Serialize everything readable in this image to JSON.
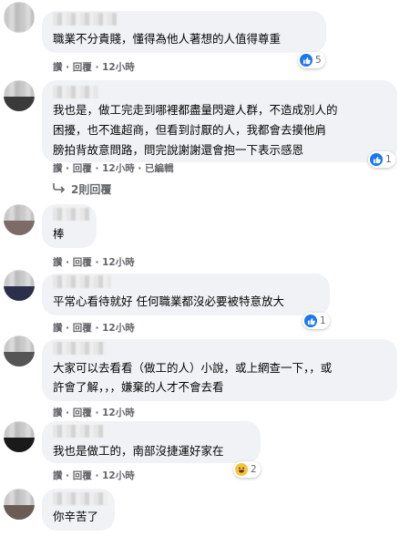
{
  "comments": [
    {
      "text": "職業不分貴賤，懂得為他人著想的人值得尊重",
      "meta": "讚 · 回覆 · 12小時",
      "reaction_count": "5"
    },
    {
      "text_line1": "我也是，做工完走到哪裡都盡量閃避人群，不造成別人的",
      "text_line2": "困擾，也不進超商，但看到討厭的人，我都會去摸他肩",
      "text_line3": "膀拍背故意問路，問完說謝謝還會抱一下表示感恩",
      "meta": "讚 · 回覆 · 12小時 · 已編輯",
      "reaction_count": "1",
      "replies_label": "2則回覆"
    },
    {
      "text": "棒",
      "meta": "讚 · 回覆 · 12小時"
    },
    {
      "text": "平常心看待就好 任何職業都沒必要被特意放大",
      "meta": "讚 · 回覆 · 12小時",
      "reaction_count": "1"
    },
    {
      "text_line1": "大家可以去看看（做工的人）小說，或上網查一下，，或",
      "text_line2": "許會了解，，，嫌棄的人才不會去看",
      "meta": "讚 · 回覆 · 12小時"
    },
    {
      "text": "我也是做工的，南部沒捷運好家在",
      "meta": "讚 · 回覆 · 12小時",
      "reaction_count": "2"
    },
    {
      "text": "你辛苦了"
    }
  ],
  "reactions": {
    "like_color": "#1877f2",
    "haha_color": "#f7c33b"
  },
  "icons": [
    "like-icon",
    "haha-icon",
    "reply-arrow-icon"
  ]
}
